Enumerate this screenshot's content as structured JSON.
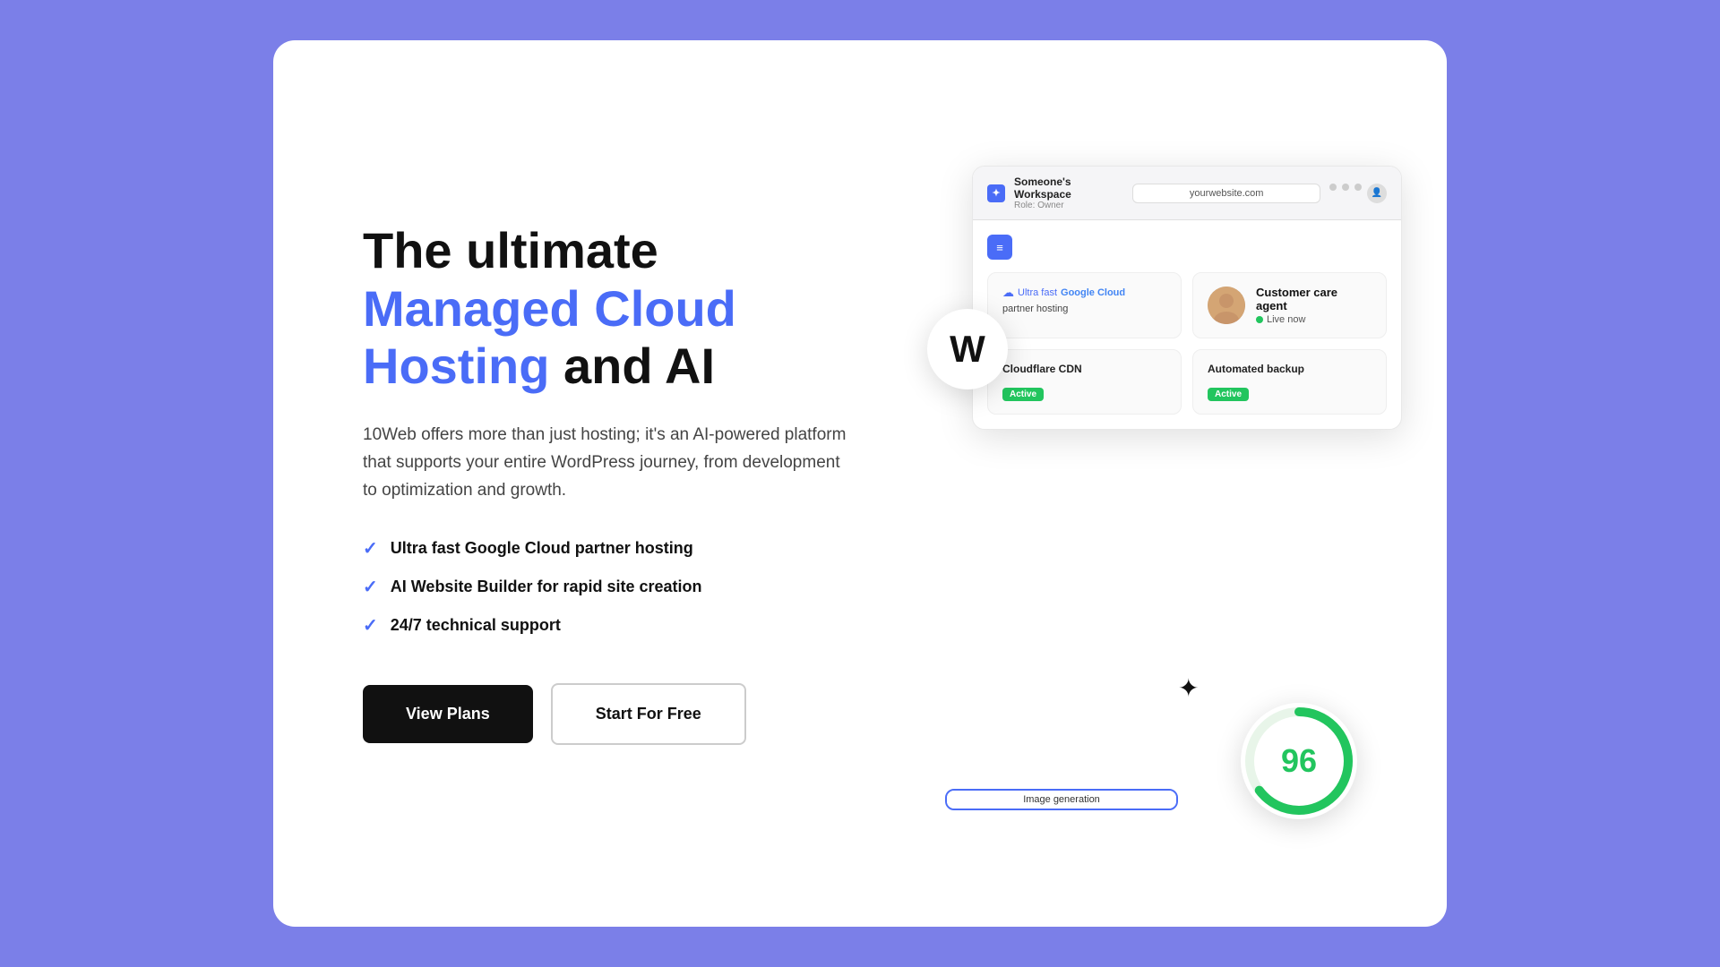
{
  "page": {
    "background_color": "#7b7fe8",
    "card_bg": "#ffffff"
  },
  "headline": {
    "part1": "The ultimate ",
    "part2": "Managed Cloud Hosting",
    "part3": " and AI"
  },
  "description": "10Web offers more than just hosting; it's an AI-powered platform that supports your entire WordPress journey, from development to optimization and growth.",
  "features": [
    {
      "text": "Ultra fast Google Cloud partner hosting"
    },
    {
      "text": "AI Website Builder for rapid site creation"
    },
    {
      "text": "24/7 technical support"
    }
  ],
  "buttons": {
    "primary": "View Plans",
    "secondary": "Start For Free"
  },
  "mockup": {
    "topbar": {
      "workspace": "Someone's Workspace",
      "role": "Role: Owner",
      "url": "yourwebsite.com"
    },
    "cards": {
      "hosting": {
        "label": "Ultra fast",
        "provider": "Google Cloud",
        "subtitle": "partner hosting"
      },
      "agent": {
        "name": "Customer care agent",
        "status": "Live now"
      },
      "cloudflare": {
        "title": "Cloudflare CDN",
        "badge": "Active"
      },
      "backup": {
        "title": "Automated backup",
        "badge": "Active"
      }
    },
    "image_generation": {
      "label": "Image generation"
    },
    "score": {
      "value": "96"
    },
    "w_logo": "W"
  }
}
